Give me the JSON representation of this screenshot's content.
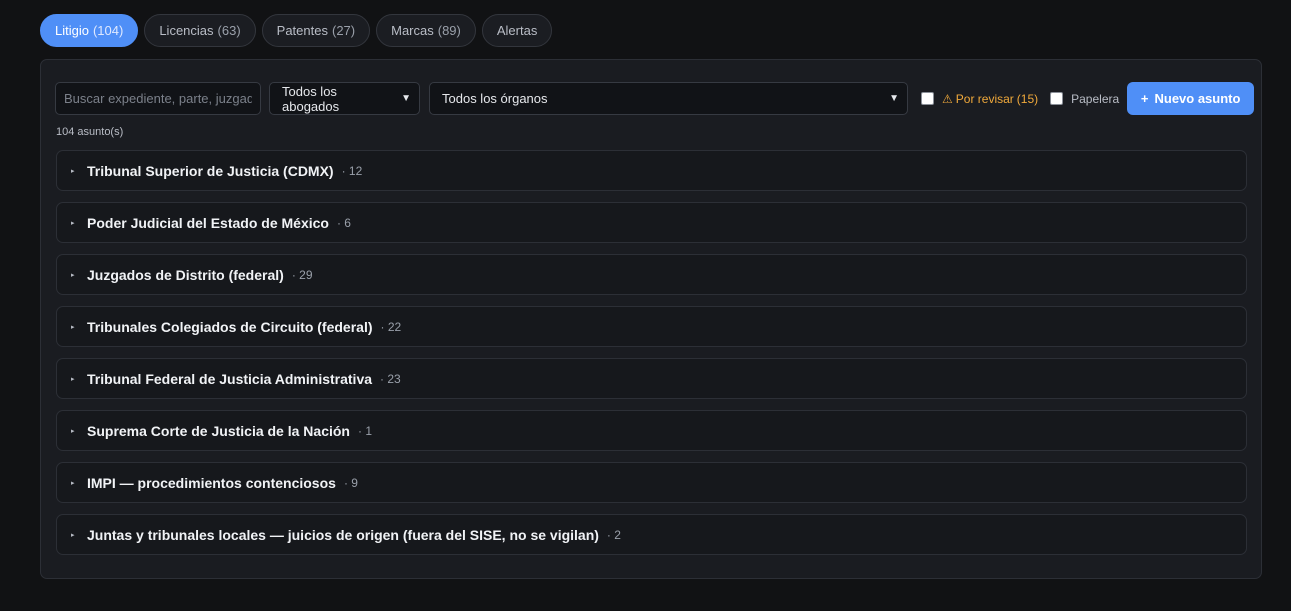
{
  "tabs": [
    {
      "label": "Litigio",
      "count": "(104)",
      "active": true
    },
    {
      "label": "Licencias",
      "count": "(63)"
    },
    {
      "label": "Patentes",
      "count": "(27)"
    },
    {
      "label": "Marcas",
      "count": "(89)"
    },
    {
      "label": "Alertas",
      "count": ""
    }
  ],
  "toolbar": {
    "search_placeholder": "Buscar expediente, parte, juzgado",
    "lawyers_selected": "Todos los abogados",
    "organs_selected": "Todos los órganos",
    "review_label": "Por revisar",
    "review_count": "(15)",
    "review_icon": "⚠",
    "trash_label": "Papelera",
    "new_button_icon": "+",
    "new_button_label": "Nuevo asunto"
  },
  "summary": {
    "count_text": "104 asunto(s)"
  },
  "groups": [
    {
      "name": "Tribunal Superior de Justicia (CDMX)",
      "count": "· 12"
    },
    {
      "name": "Poder Judicial del Estado de México",
      "count": "· 6"
    },
    {
      "name": "Juzgados de Distrito (federal)",
      "count": "· 29"
    },
    {
      "name": "Tribunales Colegiados de Circuito (federal)",
      "count": "· 22"
    },
    {
      "name": "Tribunal Federal de Justicia Administrativa",
      "count": "· 23"
    },
    {
      "name": "Suprema Corte de Justicia de la Nación",
      "count": "· 1"
    },
    {
      "name": "IMPI — procedimientos contenciosos",
      "count": "· 9"
    },
    {
      "name": "Juntas y tribunales locales — juicios de origen (fuera del SISE, no se vigilan)",
      "count": "· 2"
    }
  ],
  "colors": {
    "accent": "#4f8ff7",
    "warning": "#f0a93b",
    "background": "#111214",
    "panel": "#1a1c21"
  }
}
